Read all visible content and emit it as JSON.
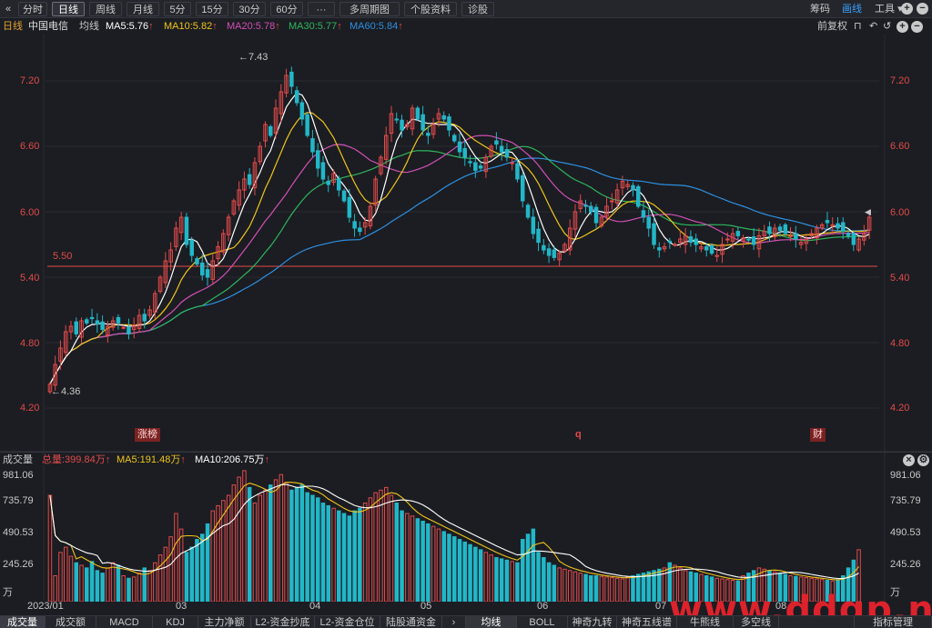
{
  "toolbar": {
    "collapse_icon": "double-chevron-left-icon",
    "periods": [
      "分时",
      "日线",
      "周线",
      "月线",
      "5分",
      "15分",
      "30分",
      "60分",
      "···",
      "多周期图",
      "个股资料",
      "诊股"
    ],
    "active_period": "日线",
    "right": {
      "chips": "筹码",
      "draw": "画线",
      "tools": "工具"
    }
  },
  "header": {
    "period": "日线",
    "stock_name": "中国电信",
    "avg_label": "均线",
    "ma5": "MA5:5.76",
    "ma10": "MA10:5.82",
    "ma20": "MA20:5.78",
    "ma30": "MA30:5.77",
    "ma60": "MA60:5.84",
    "adjust": "前复权"
  },
  "colors": {
    "up": "#e34a4a",
    "down": "#22b7c8",
    "ma5": "#ffffff",
    "ma10": "#f0c419",
    "ma20": "#d34fb5",
    "ma30": "#2fb55d",
    "ma60": "#2e8fe0",
    "background": "#1b1d22"
  },
  "price_axis": [
    "7.20",
    "6.60",
    "6.00",
    "5.40",
    "4.80",
    "4.20"
  ],
  "annotations": {
    "high": "7.43",
    "low": "4.36",
    "ref_line_value": "5.50",
    "ref_line_label": "5.50"
  },
  "events": [
    "涨榜",
    "q",
    "财"
  ],
  "volume": {
    "title": "成交量",
    "total": "总量:399.84万",
    "ma5": "MA5:191.48万",
    "ma10": "MA10:206.75万",
    "axis": [
      "981.06",
      "735.79",
      "490.53",
      "245.26",
      "万"
    ]
  },
  "dates": [
    "2023/01",
    "03",
    "04",
    "05",
    "06",
    "07",
    "08"
  ],
  "bottom_tabs": [
    "成交量",
    "成交额",
    "MACD",
    "KDJ",
    "主力净额",
    "L2-资金抄底",
    "L2-资金仓位",
    "陆股通资金",
    "均线",
    "BOLL",
    "神奇九转",
    "神奇五线谱",
    "牛熊线",
    "多空线",
    "指标管理"
  ],
  "watermark": "www.ddgp.net",
  "chart_data": {
    "type": "candlestick",
    "stock": "中国电信",
    "period": "日线",
    "ylim": [
      4.1,
      7.5
    ],
    "price_ticks": [
      7.2,
      6.6,
      6.0,
      5.4,
      4.8,
      4.2
    ],
    "high": 7.43,
    "low": 4.36,
    "reference_line": 5.5,
    "ohlc_start": 4.4,
    "closes": [
      4.42,
      4.6,
      4.75,
      4.9,
      4.95,
      4.88,
      5.0,
      4.98,
      5.02,
      4.97,
      4.92,
      4.95,
      5.0,
      4.98,
      4.94,
      4.88,
      4.96,
      5.05,
      5.0,
      5.1,
      5.25,
      5.4,
      5.55,
      5.65,
      5.85,
      5.95,
      5.7,
      5.6,
      5.52,
      5.42,
      5.4,
      5.55,
      5.68,
      5.8,
      5.95,
      6.1,
      6.2,
      6.3,
      6.25,
      6.45,
      6.6,
      6.8,
      6.7,
      6.95,
      7.1,
      7.25,
      7.15,
      7.0,
      6.85,
      6.7,
      6.55,
      6.4,
      6.3,
      6.25,
      6.35,
      6.2,
      6.1,
      5.95,
      5.85,
      5.82,
      5.9,
      6.05,
      6.3,
      6.5,
      6.7,
      6.9,
      6.85,
      6.75,
      6.8,
      6.95,
      6.85,
      6.75,
      6.7,
      6.8,
      6.9,
      6.85,
      6.75,
      6.65,
      6.55,
      6.5,
      6.45,
      6.38,
      6.4,
      6.5,
      6.6,
      6.62,
      6.55,
      6.5,
      6.45,
      6.3,
      6.1,
      5.95,
      5.8,
      5.72,
      5.65,
      5.6,
      5.58,
      5.62,
      5.7,
      5.85,
      6.0,
      6.1,
      6.05,
      6.0,
      5.9,
      5.95,
      6.05,
      6.1,
      6.2,
      6.28,
      6.25,
      6.2,
      6.05,
      5.95,
      5.85,
      5.7,
      5.65,
      5.68,
      5.72,
      5.7,
      5.75,
      5.78,
      5.72,
      5.7,
      5.68,
      5.65,
      5.62,
      5.6,
      5.7,
      5.75,
      5.8,
      5.78,
      5.76,
      5.74,
      5.7,
      5.78,
      5.82,
      5.8,
      5.85,
      5.83,
      5.8,
      5.78,
      5.75,
      5.72,
      5.75,
      5.8,
      5.85,
      5.88,
      5.9,
      5.88,
      5.85,
      5.82,
      5.78,
      5.7,
      5.75,
      5.8,
      5.95
    ],
    "volume": {
      "axis_ticks": [
        981.06,
        735.79,
        490.53,
        245.26
      ],
      "ylim": [
        0,
        1030
      ],
      "values": [
        820,
        200,
        380,
        420,
        350,
        300,
        280,
        260,
        310,
        240,
        220,
        260,
        300,
        280,
        200,
        180,
        190,
        220,
        260,
        240,
        300,
        360,
        420,
        500,
        680,
        560,
        380,
        420,
        480,
        520,
        600,
        700,
        740,
        780,
        820,
        900,
        960,
        1010,
        880,
        760,
        820,
        860,
        900,
        940,
        980,
        920,
        860,
        880,
        900,
        840,
        820,
        800,
        760,
        740,
        720,
        700,
        680,
        660,
        700,
        720,
        760,
        800,
        840,
        860,
        880,
        820,
        760,
        700,
        680,
        660,
        640,
        620,
        600,
        580,
        560,
        540,
        520,
        500,
        480,
        460,
        440,
        420,
        400,
        380,
        360,
        340,
        330,
        320,
        310,
        300,
        480,
        520,
        560,
        380,
        340,
        300,
        280,
        260,
        250,
        240,
        230,
        220,
        210,
        200,
        200,
        195,
        190,
        185,
        180,
        175,
        190,
        200,
        210,
        220,
        230,
        240,
        250,
        260,
        300,
        280,
        260,
        240,
        230,
        220,
        210,
        200,
        190,
        180,
        175,
        170,
        165,
        160,
        200,
        220,
        240,
        260,
        250,
        240,
        230,
        220,
        210,
        200,
        195,
        190,
        185,
        180,
        175,
        170,
        165,
        160,
        170,
        200,
        260,
        320,
        400
      ]
    }
  }
}
